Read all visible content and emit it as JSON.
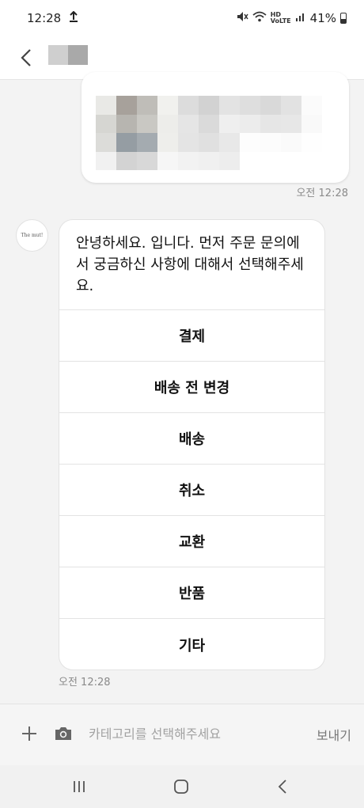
{
  "status_bar": {
    "time": "12:28",
    "battery": "41%",
    "icons": [
      "upload-arrow-icon",
      "mute-icon",
      "wifi-icon",
      "hd-voice-icon",
      "signal-icon",
      "battery-icon"
    ]
  },
  "header": {
    "back_icon": "chevron-left-icon"
  },
  "messages": {
    "sent_image_time": "오전 12:28",
    "bot_avatar_text": "The mut!",
    "bot_text": "안녕하세요.        입니다. 먼저 주문 문의에서 궁금하신 사항에 대해서 선택해주세요.",
    "options": [
      "결제",
      "배송 전 변경",
      "배송",
      "취소",
      "교환",
      "반품",
      "기타"
    ],
    "bot_time": "오전 12:28"
  },
  "input": {
    "placeholder": "카테고리를 선택해주세요",
    "send_label": "보내기"
  },
  "colors": {
    "background": "#f3f3f3",
    "bubble": "#ffffff",
    "muted_text": "#8a8a8a"
  }
}
